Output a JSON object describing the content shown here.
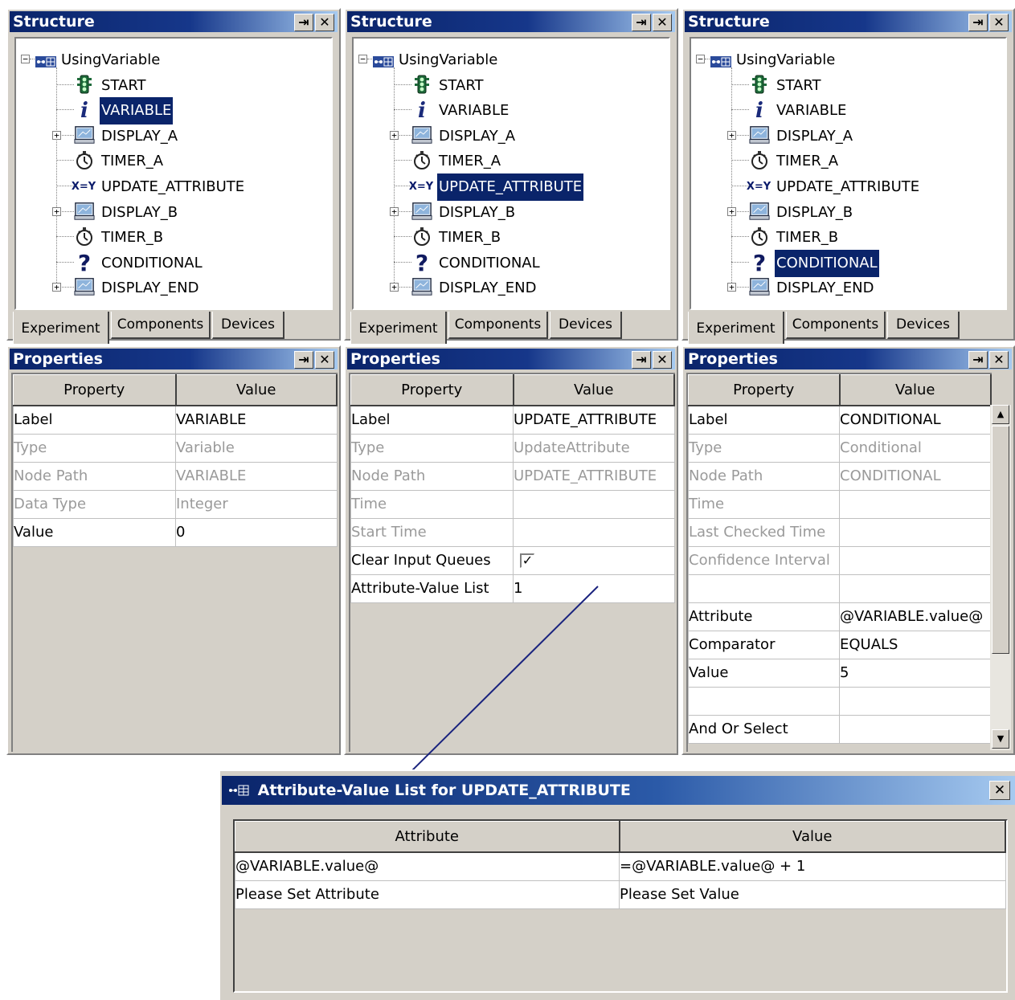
{
  "structure_panels": [
    {
      "title": "Structure",
      "root": "UsingVariable",
      "selected": "VARIABLE",
      "nodes": [
        "START",
        "VARIABLE",
        "DISPLAY_A",
        "TIMER_A",
        "UPDATE_ATTRIBUTE",
        "DISPLAY_B",
        "TIMER_B",
        "CONDITIONAL",
        "DISPLAY_END"
      ],
      "tabs": [
        "Experiment",
        "Components",
        "Devices"
      ]
    },
    {
      "title": "Structure",
      "root": "UsingVariable",
      "selected": "UPDATE_ATTRIBUTE",
      "nodes": [
        "START",
        "VARIABLE",
        "DISPLAY_A",
        "TIMER_A",
        "UPDATE_ATTRIBUTE",
        "DISPLAY_B",
        "TIMER_B",
        "CONDITIONAL",
        "DISPLAY_END"
      ],
      "tabs": [
        "Experiment",
        "Components",
        "Devices"
      ]
    },
    {
      "title": "Structure",
      "root": "UsingVariable",
      "selected": "CONDITIONAL",
      "nodes": [
        "START",
        "VARIABLE",
        "DISPLAY_A",
        "TIMER_A",
        "UPDATE_ATTRIBUTE",
        "DISPLAY_B",
        "TIMER_B",
        "CONDITIONAL",
        "DISPLAY_END"
      ],
      "tabs": [
        "Experiment",
        "Components",
        "Devices"
      ]
    }
  ],
  "node_icons": {
    "START": "traffic-light-icon",
    "VARIABLE": "info-icon",
    "DISPLAY_A": "monitor-icon",
    "TIMER_A": "stopwatch-icon",
    "UPDATE_ATTRIBUTE": "assign-xy-icon",
    "DISPLAY_B": "monitor-icon",
    "TIMER_B": "stopwatch-icon",
    "CONDITIONAL": "question-icon",
    "DISPLAY_END": "monitor-icon"
  },
  "expandable_nodes": [
    "DISPLAY_A",
    "DISPLAY_B",
    "DISPLAY_END"
  ],
  "properties_panels": [
    {
      "title": "Properties",
      "header": {
        "property": "Property",
        "value": "Value"
      },
      "rows": [
        {
          "property": "Label",
          "value": "VARIABLE",
          "dim": false
        },
        {
          "property": "Type",
          "value": "Variable",
          "dim": true
        },
        {
          "property": "Node Path",
          "value": "VARIABLE",
          "dim": true
        },
        {
          "property": "Data Type",
          "value": "Integer",
          "dim": true
        },
        {
          "property": "Value",
          "value": "0",
          "dim": false
        }
      ]
    },
    {
      "title": "Properties",
      "header": {
        "property": "Property",
        "value": "Value"
      },
      "rows": [
        {
          "property": "Label",
          "value": "UPDATE_ATTRIBUTE",
          "dim": false
        },
        {
          "property": "Type",
          "value": "UpdateAttribute",
          "dim": true
        },
        {
          "property": "Node Path",
          "value": "UPDATE_ATTRIBUTE",
          "dim": true
        },
        {
          "property": "Time",
          "value": "",
          "dim": true
        },
        {
          "property": "Start Time",
          "value": "",
          "dim": true
        },
        {
          "property": "Clear Input Queues",
          "value": "",
          "dim": false,
          "checkbox": true,
          "checked": true
        },
        {
          "property": "Attribute-Value List",
          "value": "1",
          "dim": false
        }
      ]
    },
    {
      "title": "Properties",
      "header": {
        "property": "Property",
        "value": "Value"
      },
      "rows": [
        {
          "property": "Label",
          "value": "CONDITIONAL",
          "dim": false
        },
        {
          "property": "Type",
          "value": "Conditional",
          "dim": true
        },
        {
          "property": "Node Path",
          "value": "CONDITIONAL",
          "dim": true
        },
        {
          "property": "Time",
          "value": "",
          "dim": true
        },
        {
          "property": "Last Checked Time",
          "value": "",
          "dim": true
        },
        {
          "property": "Confidence Interval",
          "value": "",
          "dim": true
        },
        {
          "property": "",
          "value": "",
          "dim": false
        },
        {
          "property": "Attribute",
          "value": "@VARIABLE.value@",
          "dim": false
        },
        {
          "property": "Comparator",
          "value": "EQUALS",
          "dim": false
        },
        {
          "property": "Value",
          "value": "5",
          "dim": false
        },
        {
          "property": "",
          "value": "",
          "dim": false
        },
        {
          "property": "And Or Select",
          "value": "",
          "dim": false
        }
      ]
    }
  ],
  "dialog": {
    "title": "Attribute-Value List for UPDATE_ATTRIBUTE",
    "header": {
      "attribute": "Attribute",
      "value": "Value"
    },
    "rows": [
      {
        "attribute": "@VARIABLE.value@",
        "value": "=@VARIABLE.value@ + 1"
      },
      {
        "attribute": "Please Set Attribute",
        "value": "Please Set Value"
      }
    ]
  },
  "colors": {
    "title_bar": "#0a246a",
    "selection": "#0a246a",
    "panel_bg": "#d4d0c8",
    "connector_line": "#1a237e"
  }
}
